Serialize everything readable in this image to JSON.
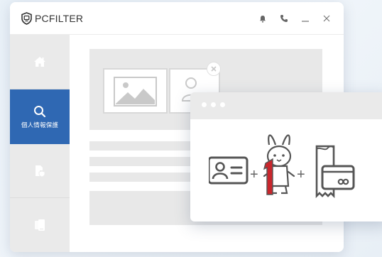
{
  "app": {
    "brand": "PCFILTER"
  },
  "titlebar": {
    "controls": [
      {
        "name": "notification-bell-icon"
      },
      {
        "name": "phone-icon"
      },
      {
        "name": "minimize-icon",
        "glyph": "_"
      },
      {
        "name": "close-icon",
        "glyph": "×"
      }
    ]
  },
  "sidebar": {
    "items": [
      {
        "icon": "home-icon",
        "label": "",
        "active": false
      },
      {
        "icon": "search-icon",
        "label": "個人情報保護",
        "active": true
      },
      {
        "icon": "file-shield-icon",
        "label": "",
        "active": false
      },
      {
        "icon": "mobile-icon",
        "label": "",
        "active": false
      }
    ]
  },
  "popup": {
    "equation": [
      {
        "icon": "id-card-icon"
      },
      {
        "symbol": "+"
      },
      {
        "icon": "my-number-rabbit-icon"
      },
      {
        "symbol": "+"
      },
      {
        "icon": "credit-card-receipt-icon"
      }
    ]
  },
  "colors": {
    "accent": "#2f68b3",
    "sidebar_bg": "#eaeaea",
    "placeholder": "#e8e8e8",
    "icon_dark": "#555555",
    "rabbit_red": "#c9262c"
  }
}
